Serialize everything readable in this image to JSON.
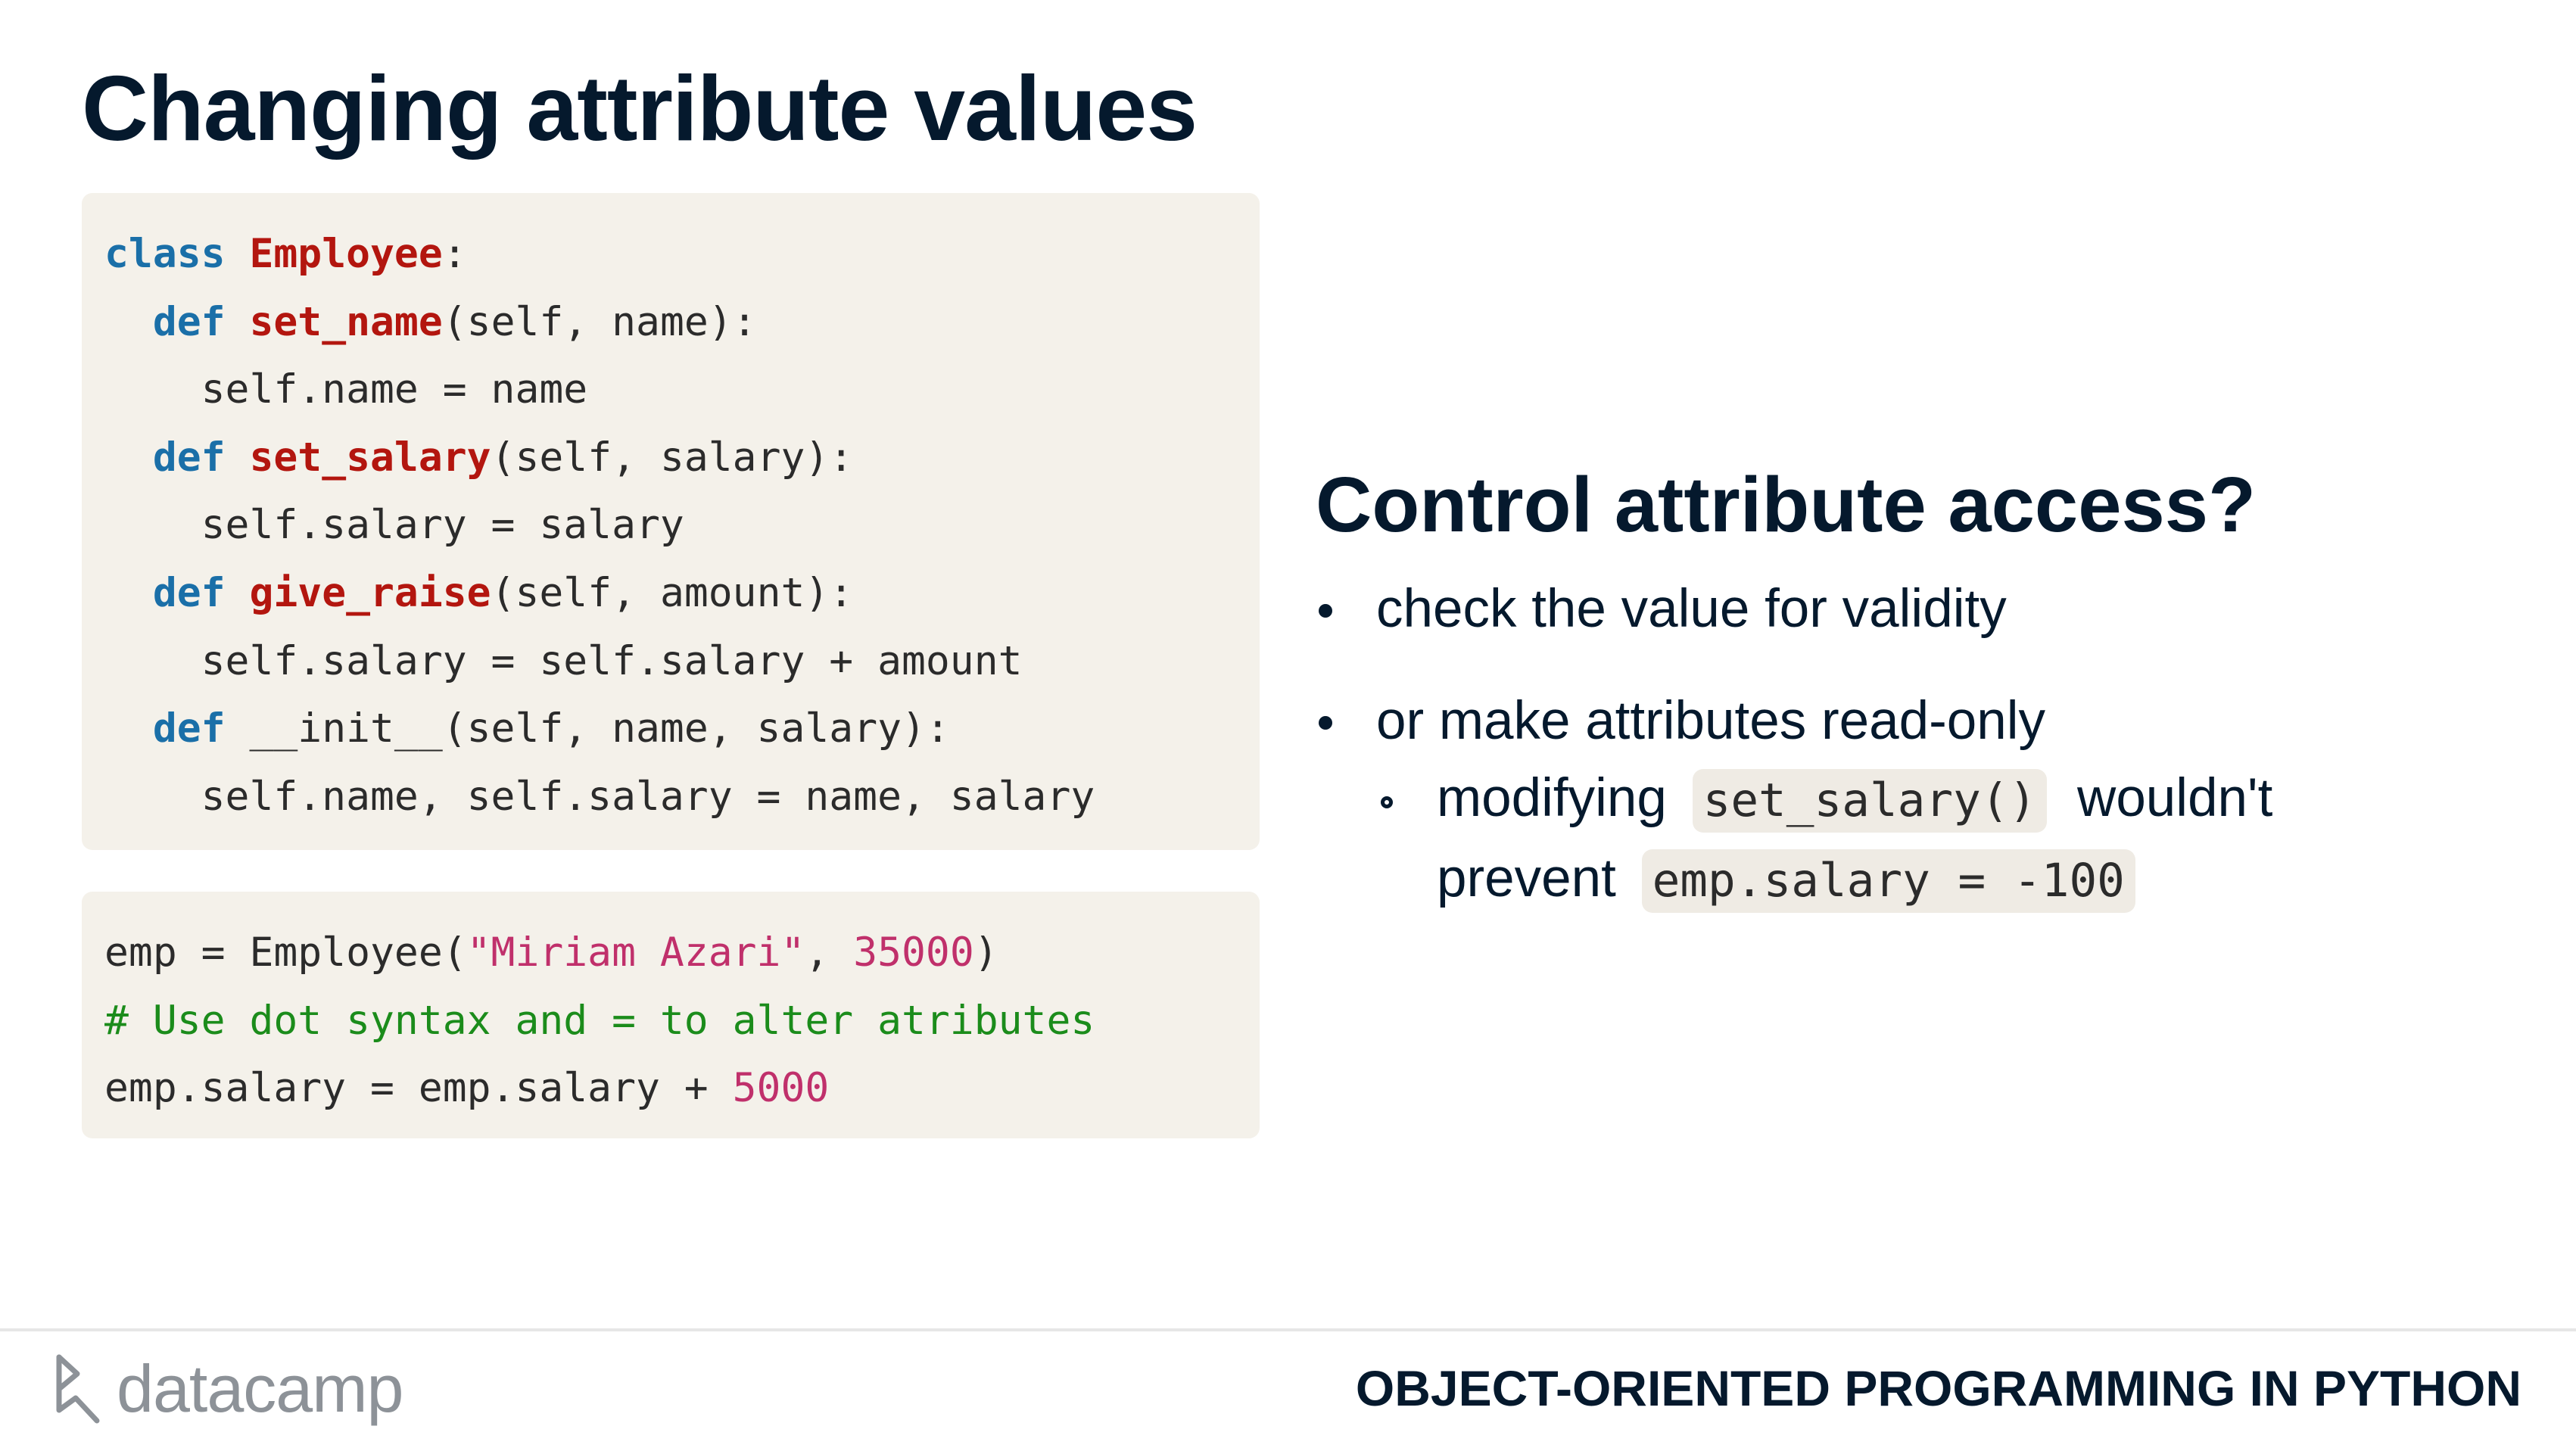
{
  "slide": {
    "title": "Changing attribute values"
  },
  "code_block_1": {
    "lines": [
      [
        {
          "t": "class",
          "c": "kw"
        },
        {
          "t": " "
        },
        {
          "t": "Employee",
          "c": "name"
        },
        {
          "t": ":"
        }
      ],
      [
        {
          "t": "  "
        },
        {
          "t": "def",
          "c": "kw"
        },
        {
          "t": " "
        },
        {
          "t": "set_name",
          "c": "name"
        },
        {
          "t": "(self, name):"
        }
      ],
      [
        {
          "t": "    self.name = name"
        }
      ],
      [
        {
          "t": "  "
        },
        {
          "t": "def",
          "c": "kw"
        },
        {
          "t": " "
        },
        {
          "t": "set_salary",
          "c": "name"
        },
        {
          "t": "(self, salary):"
        }
      ],
      [
        {
          "t": "    self.salary = salary"
        }
      ],
      [
        {
          "t": "  "
        },
        {
          "t": "def",
          "c": "kw"
        },
        {
          "t": " "
        },
        {
          "t": "give_raise",
          "c": "name"
        },
        {
          "t": "(self, amount):"
        }
      ],
      [
        {
          "t": "    self.salary = self.salary + amount"
        }
      ],
      [
        {
          "t": "  "
        },
        {
          "t": "def",
          "c": "kw"
        },
        {
          "t": " __init__(self, name, salary):"
        }
      ],
      [
        {
          "t": "    self.name, self.salary = name, salary"
        }
      ]
    ]
  },
  "code_block_2": {
    "lines": [
      [
        {
          "t": "emp = Employee("
        },
        {
          "t": "\"Miriam Azari\"",
          "c": "str"
        },
        {
          "t": ", "
        },
        {
          "t": "35000",
          "c": "num"
        },
        {
          "t": ")"
        }
      ],
      [
        {
          "t": "# Use dot syntax and = to alter atributes",
          "c": "comment"
        }
      ],
      [
        {
          "t": "emp.salary = emp.salary + "
        },
        {
          "t": "5000",
          "c": "num"
        }
      ]
    ]
  },
  "right_panel": {
    "heading": "Control attribute access?",
    "bullet_1": "check the value for validity",
    "bullet_2": "or make attributes read-only",
    "sub_bullet": {
      "text_1": "modifying",
      "code_1": "set_salary()",
      "text_2": "wouldn't",
      "text_3": "prevent",
      "code_2": "emp.salary = -100"
    }
  },
  "footer": {
    "logo_text": "datacamp",
    "course_title": "OBJECT-ORIENTED PROGRAMMING IN PYTHON"
  },
  "colors": {
    "keyword": "#1a6fa8",
    "identifier": "#b3160f",
    "string": "#c0306b",
    "comment": "#1b8c1b",
    "code_bg": "#f4f1ea",
    "text": "#05192d"
  }
}
